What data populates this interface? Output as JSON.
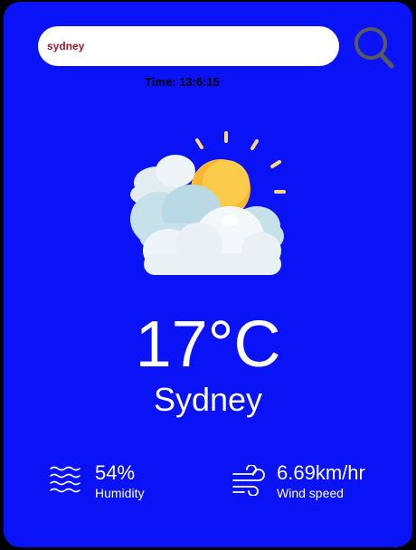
{
  "search": {
    "value": "sydney",
    "icon": "search-icon"
  },
  "time": {
    "text": "Time: 13:6:15"
  },
  "weather": {
    "icon": "partly-cloudy-icon",
    "temperature": "17°C",
    "city": "Sydney"
  },
  "details": {
    "humidity": {
      "icon": "humidity-waves-icon",
      "value": "54%",
      "label": "Humidity"
    },
    "wind": {
      "icon": "wind-icon",
      "value": "6.69km/hr",
      "label": "Wind speed"
    }
  },
  "colors": {
    "card_background": "#0a13f6",
    "page_background": "#000000",
    "search_text": "#a0162a",
    "search_icon": "#5a5a5a",
    "sun": "#f9b82e",
    "sun_rays": "#ffd873",
    "cloud": "#e9f1f5",
    "text": "#ffffff"
  }
}
